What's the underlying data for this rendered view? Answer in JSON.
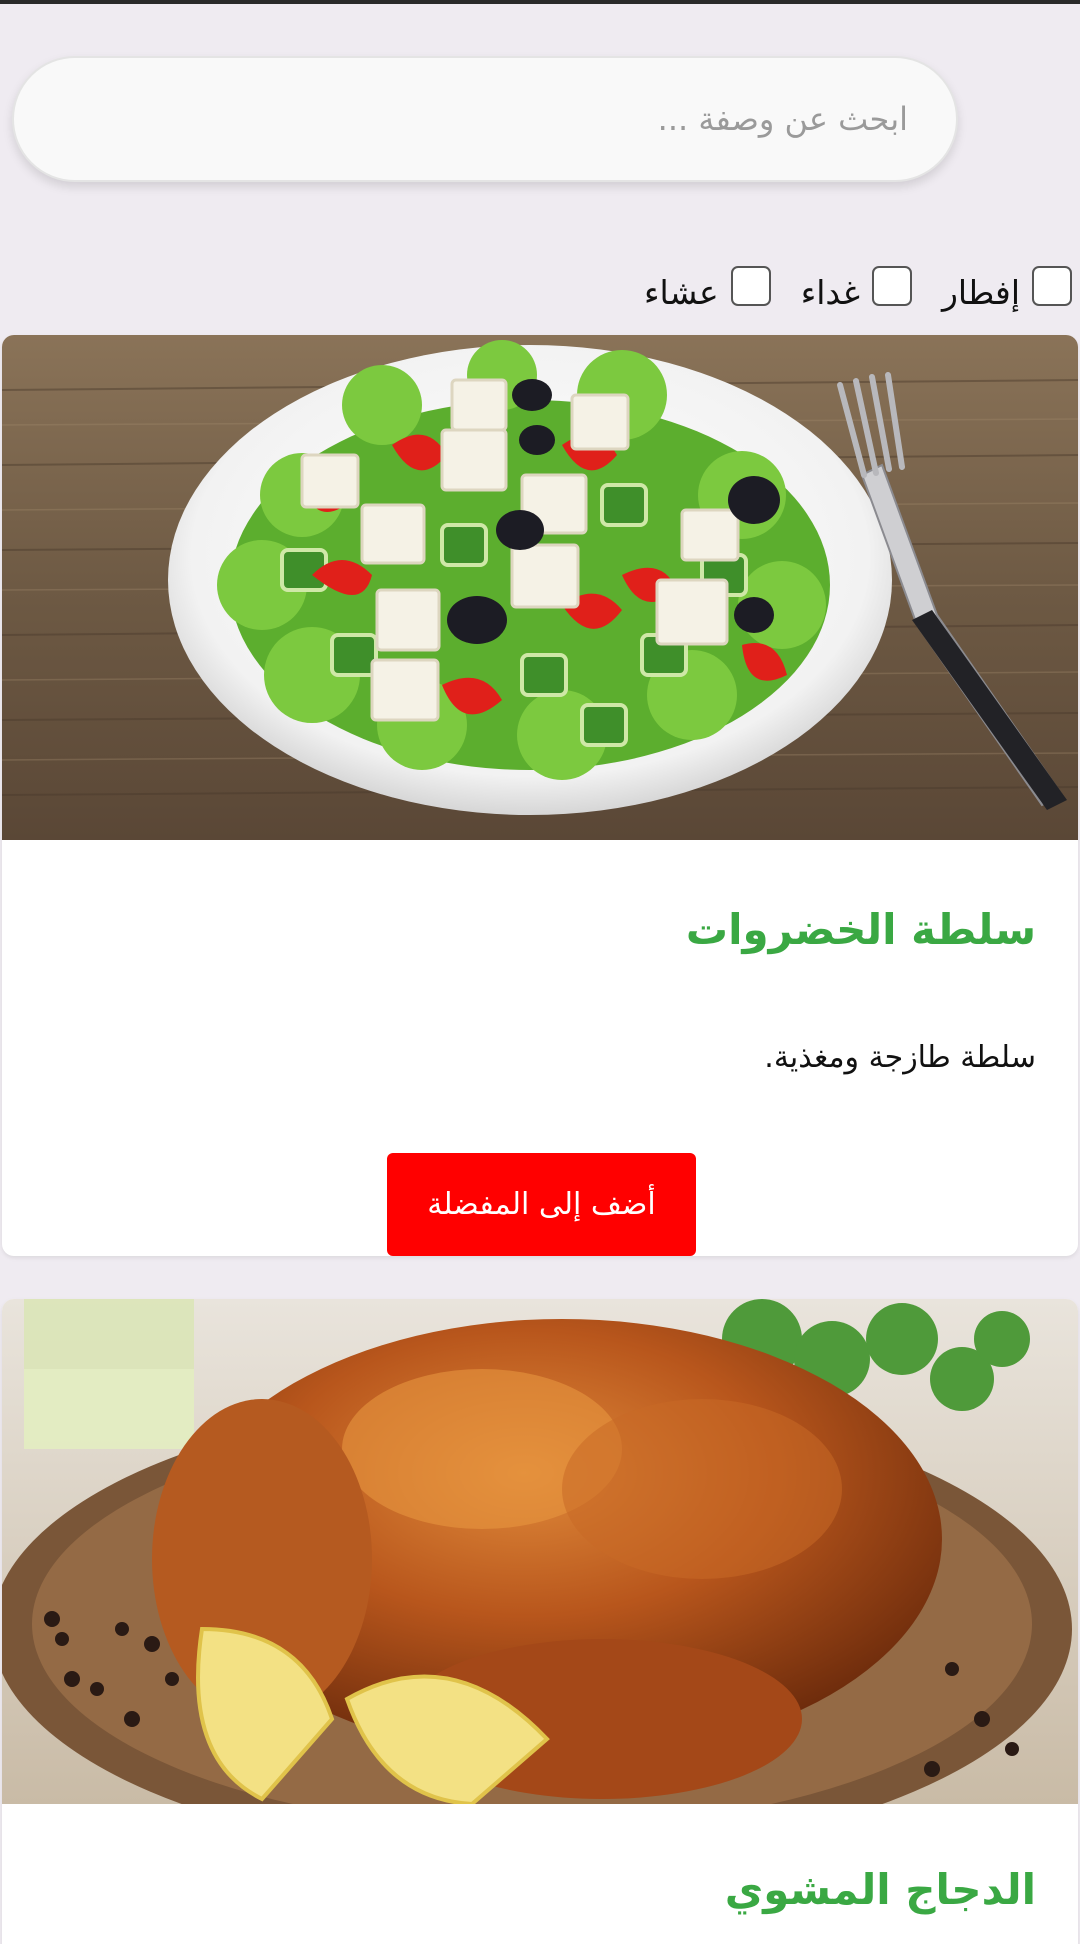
{
  "search": {
    "placeholder": "ابحث عن وصفة ..."
  },
  "filters": [
    {
      "label": "إفطار"
    },
    {
      "label": "غداء"
    },
    {
      "label": "عشاء"
    }
  ],
  "recipes": [
    {
      "title": "سلطة الخضروات",
      "description": "سلطة طازجة ومغذية.",
      "button_label": "أضف إلى المفضلة",
      "image": "greek-salad-photo"
    },
    {
      "title": "الدجاج المشوي",
      "image": "roast-chicken-photo"
    }
  ],
  "colors": {
    "background": "#efebf1",
    "title_green": "#3aa843",
    "favorite_red": "#ff0000"
  }
}
